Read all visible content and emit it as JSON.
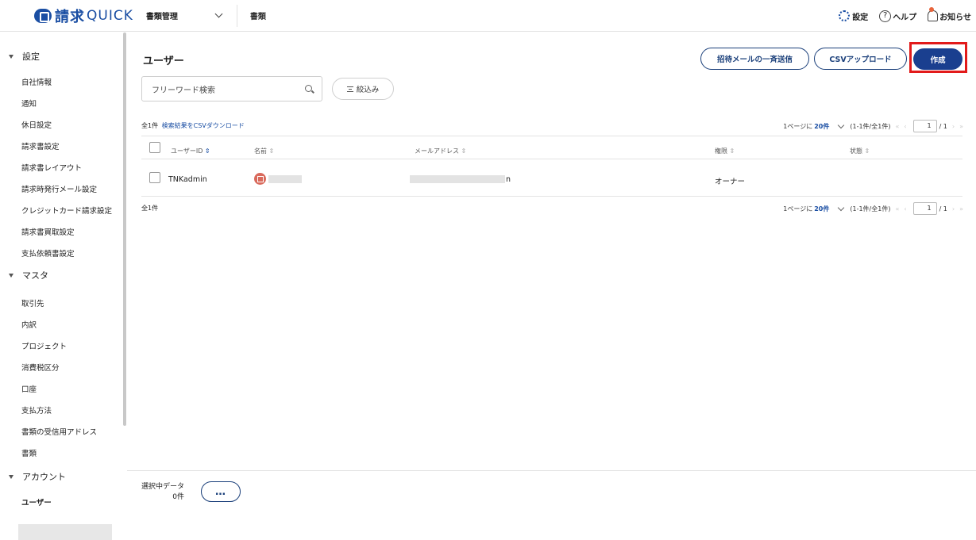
{
  "header": {
    "logo_kanji": "請求",
    "logo_quick": "QUICK",
    "module": "書類管理",
    "docs_link": "書類",
    "settings": "設定",
    "help": "ヘルプ",
    "notices": "お知らせ",
    "icons": [
      "gear-icon",
      "help-icon",
      "bell-icon",
      "chevron-down-icon"
    ]
  },
  "sidebar": {
    "settings_section": "設定",
    "settings_items": [
      "自社情報",
      "通知",
      "休日設定",
      "請求書設定",
      "請求書レイアウト",
      "請求時発行メール設定",
      "クレジットカード請求設定",
      "請求書買取設定",
      "支払依頼書設定"
    ],
    "master_section": "マスタ",
    "master_items": [
      "取引先",
      "内訳",
      "プロジェクト",
      "消費税区分",
      "口座",
      "支払方法",
      "書類の受信用アドレス",
      "書類"
    ],
    "account_section": "アカウント",
    "account_items": [
      "ユーザー"
    ]
  },
  "main": {
    "title": "ユーザー",
    "invite_button": "招待メールの一斉送信",
    "csv_upload_button": "CSVアップロード",
    "create_button": "作成",
    "search_placeholder": "フリーワード検索",
    "filter_button": "絞込み",
    "total_count": "全1件",
    "csv_download": "検索結果をCSVダウンロード",
    "pager": {
      "per_page_prefix": "1ページに",
      "per_page": "20件",
      "range": "(1-1件/全1件)",
      "page": "1",
      "total_pages": "/ 1"
    },
    "columns": [
      "ユーザーID",
      "名前",
      "メールアドレス",
      "権限",
      "状態"
    ],
    "rows": [
      {
        "user_id": "TNKadmin",
        "email_tail": "n",
        "role": "オーナー",
        "status": ""
      }
    ],
    "footer_count": "全1件"
  },
  "bottom": {
    "selected_label": "選択中データ",
    "selected_count": "0件",
    "more_button": "…"
  },
  "colors": {
    "brand": "#1a3f8f",
    "highlight": "#e21a1a",
    "avatar": "#d96a5c"
  }
}
